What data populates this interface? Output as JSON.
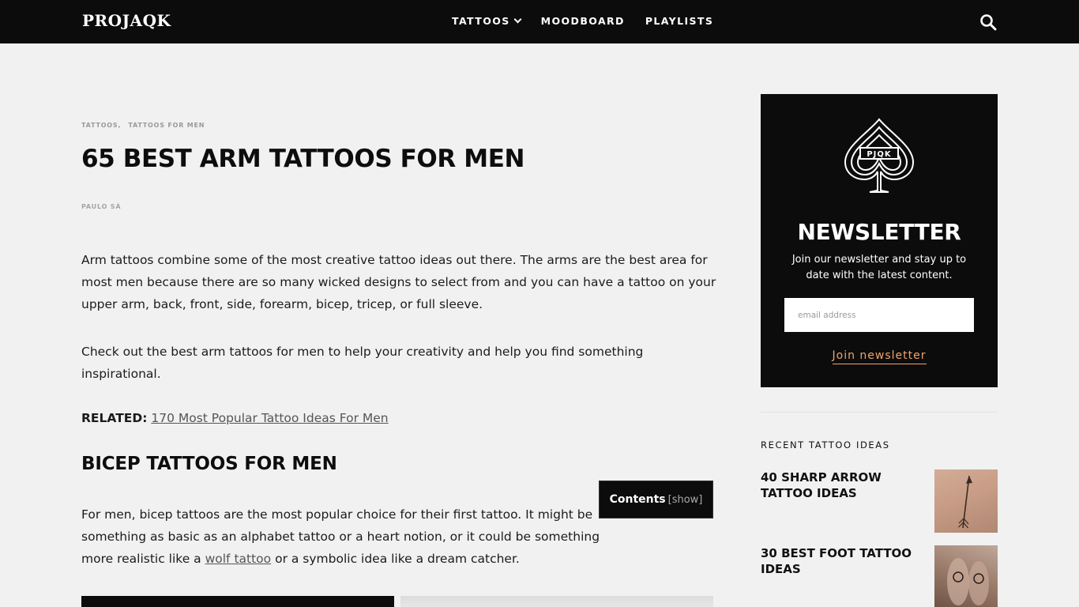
{
  "header": {
    "logo": "PROJAQK",
    "nav": [
      {
        "label": "TATTOOS",
        "has_dropdown": true
      },
      {
        "label": "MOODBOARD",
        "has_dropdown": false
      },
      {
        "label": "PLAYLISTS",
        "has_dropdown": false
      }
    ],
    "search_icon": "search-icon"
  },
  "article": {
    "breadcrumbs": [
      "TATTOOS,",
      "TATTOOS FOR MEN"
    ],
    "title": "65 BEST ARM TATTOOS FOR MEN",
    "author": "PAULO SÁ",
    "paragraph1": "Arm tattoos combine some of the most creative tattoo ideas out there. The arms are the best area for most men because there are so many wicked designs to select from and you can have a tattoo on your upper arm, back, front, side, forearm, bicep, tricep, or full sleeve.",
    "paragraph2": "Check out the best arm tattoos for men to help your creativity and help you find something inspirational.",
    "related_label": "RELATED:",
    "related_link": "170 Most Popular Tattoo Ideas For Men",
    "section_heading": "BICEP TATTOOS FOR MEN",
    "paragraph3_before": "For men, bicep tattoos are the most popular choice for their first tattoo. It might be something as basic as an alphabet tattoo or a heart notion, or it could be something more realistic like a ",
    "paragraph3_link": "wolf tattoo",
    "paragraph3_after": " or a symbolic idea like a dream catcher.",
    "toc": {
      "title": "Contents",
      "toggle": "[show]"
    }
  },
  "sidebar": {
    "newsletter": {
      "logo_text": "PJQK",
      "title": "NEWSLETTER",
      "description": "Join our newsletter and stay up to date with the latest content.",
      "input_placeholder": "email address",
      "button_label": "Join newsletter",
      "accent_color": "#f2a46a"
    },
    "recent_heading": "RECENT TATTOO IDEAS",
    "recent_items": [
      {
        "title": "40 SHARP ARROW TATTOO IDEAS"
      },
      {
        "title": "30 BEST FOOT TATTOO IDEAS"
      }
    ]
  }
}
